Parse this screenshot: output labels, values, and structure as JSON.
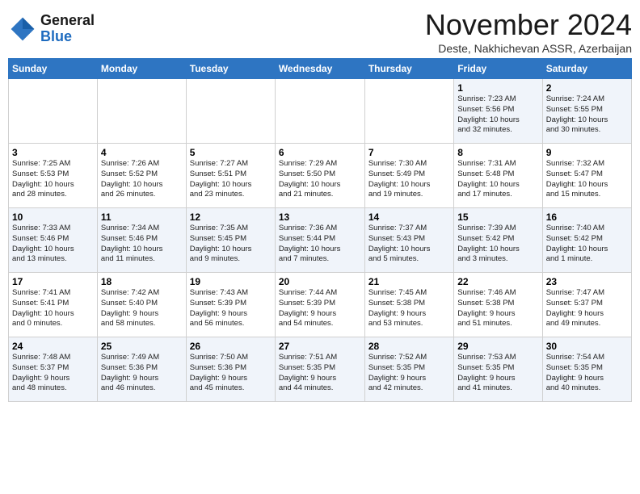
{
  "header": {
    "logo_general": "General",
    "logo_blue": "Blue",
    "month_title": "November 2024",
    "subtitle": "Deste, Nakhichevan ASSR, Azerbaijan"
  },
  "weekdays": [
    "Sunday",
    "Monday",
    "Tuesday",
    "Wednesday",
    "Thursday",
    "Friday",
    "Saturday"
  ],
  "weeks": [
    [
      {
        "day": "",
        "info": ""
      },
      {
        "day": "",
        "info": ""
      },
      {
        "day": "",
        "info": ""
      },
      {
        "day": "",
        "info": ""
      },
      {
        "day": "",
        "info": ""
      },
      {
        "day": "1",
        "info": "Sunrise: 7:23 AM\nSunset: 5:56 PM\nDaylight: 10 hours\nand 32 minutes."
      },
      {
        "day": "2",
        "info": "Sunrise: 7:24 AM\nSunset: 5:55 PM\nDaylight: 10 hours\nand 30 minutes."
      }
    ],
    [
      {
        "day": "3",
        "info": "Sunrise: 7:25 AM\nSunset: 5:53 PM\nDaylight: 10 hours\nand 28 minutes."
      },
      {
        "day": "4",
        "info": "Sunrise: 7:26 AM\nSunset: 5:52 PM\nDaylight: 10 hours\nand 26 minutes."
      },
      {
        "day": "5",
        "info": "Sunrise: 7:27 AM\nSunset: 5:51 PM\nDaylight: 10 hours\nand 23 minutes."
      },
      {
        "day": "6",
        "info": "Sunrise: 7:29 AM\nSunset: 5:50 PM\nDaylight: 10 hours\nand 21 minutes."
      },
      {
        "day": "7",
        "info": "Sunrise: 7:30 AM\nSunset: 5:49 PM\nDaylight: 10 hours\nand 19 minutes."
      },
      {
        "day": "8",
        "info": "Sunrise: 7:31 AM\nSunset: 5:48 PM\nDaylight: 10 hours\nand 17 minutes."
      },
      {
        "day": "9",
        "info": "Sunrise: 7:32 AM\nSunset: 5:47 PM\nDaylight: 10 hours\nand 15 minutes."
      }
    ],
    [
      {
        "day": "10",
        "info": "Sunrise: 7:33 AM\nSunset: 5:46 PM\nDaylight: 10 hours\nand 13 minutes."
      },
      {
        "day": "11",
        "info": "Sunrise: 7:34 AM\nSunset: 5:46 PM\nDaylight: 10 hours\nand 11 minutes."
      },
      {
        "day": "12",
        "info": "Sunrise: 7:35 AM\nSunset: 5:45 PM\nDaylight: 10 hours\nand 9 minutes."
      },
      {
        "day": "13",
        "info": "Sunrise: 7:36 AM\nSunset: 5:44 PM\nDaylight: 10 hours\nand 7 minutes."
      },
      {
        "day": "14",
        "info": "Sunrise: 7:37 AM\nSunset: 5:43 PM\nDaylight: 10 hours\nand 5 minutes."
      },
      {
        "day": "15",
        "info": "Sunrise: 7:39 AM\nSunset: 5:42 PM\nDaylight: 10 hours\nand 3 minutes."
      },
      {
        "day": "16",
        "info": "Sunrise: 7:40 AM\nSunset: 5:42 PM\nDaylight: 10 hours\nand 1 minute."
      }
    ],
    [
      {
        "day": "17",
        "info": "Sunrise: 7:41 AM\nSunset: 5:41 PM\nDaylight: 10 hours\nand 0 minutes."
      },
      {
        "day": "18",
        "info": "Sunrise: 7:42 AM\nSunset: 5:40 PM\nDaylight: 9 hours\nand 58 minutes."
      },
      {
        "day": "19",
        "info": "Sunrise: 7:43 AM\nSunset: 5:39 PM\nDaylight: 9 hours\nand 56 minutes."
      },
      {
        "day": "20",
        "info": "Sunrise: 7:44 AM\nSunset: 5:39 PM\nDaylight: 9 hours\nand 54 minutes."
      },
      {
        "day": "21",
        "info": "Sunrise: 7:45 AM\nSunset: 5:38 PM\nDaylight: 9 hours\nand 53 minutes."
      },
      {
        "day": "22",
        "info": "Sunrise: 7:46 AM\nSunset: 5:38 PM\nDaylight: 9 hours\nand 51 minutes."
      },
      {
        "day": "23",
        "info": "Sunrise: 7:47 AM\nSunset: 5:37 PM\nDaylight: 9 hours\nand 49 minutes."
      }
    ],
    [
      {
        "day": "24",
        "info": "Sunrise: 7:48 AM\nSunset: 5:37 PM\nDaylight: 9 hours\nand 48 minutes."
      },
      {
        "day": "25",
        "info": "Sunrise: 7:49 AM\nSunset: 5:36 PM\nDaylight: 9 hours\nand 46 minutes."
      },
      {
        "day": "26",
        "info": "Sunrise: 7:50 AM\nSunset: 5:36 PM\nDaylight: 9 hours\nand 45 minutes."
      },
      {
        "day": "27",
        "info": "Sunrise: 7:51 AM\nSunset: 5:35 PM\nDaylight: 9 hours\nand 44 minutes."
      },
      {
        "day": "28",
        "info": "Sunrise: 7:52 AM\nSunset: 5:35 PM\nDaylight: 9 hours\nand 42 minutes."
      },
      {
        "day": "29",
        "info": "Sunrise: 7:53 AM\nSunset: 5:35 PM\nDaylight: 9 hours\nand 41 minutes."
      },
      {
        "day": "30",
        "info": "Sunrise: 7:54 AM\nSunset: 5:35 PM\nDaylight: 9 hours\nand 40 minutes."
      }
    ]
  ]
}
